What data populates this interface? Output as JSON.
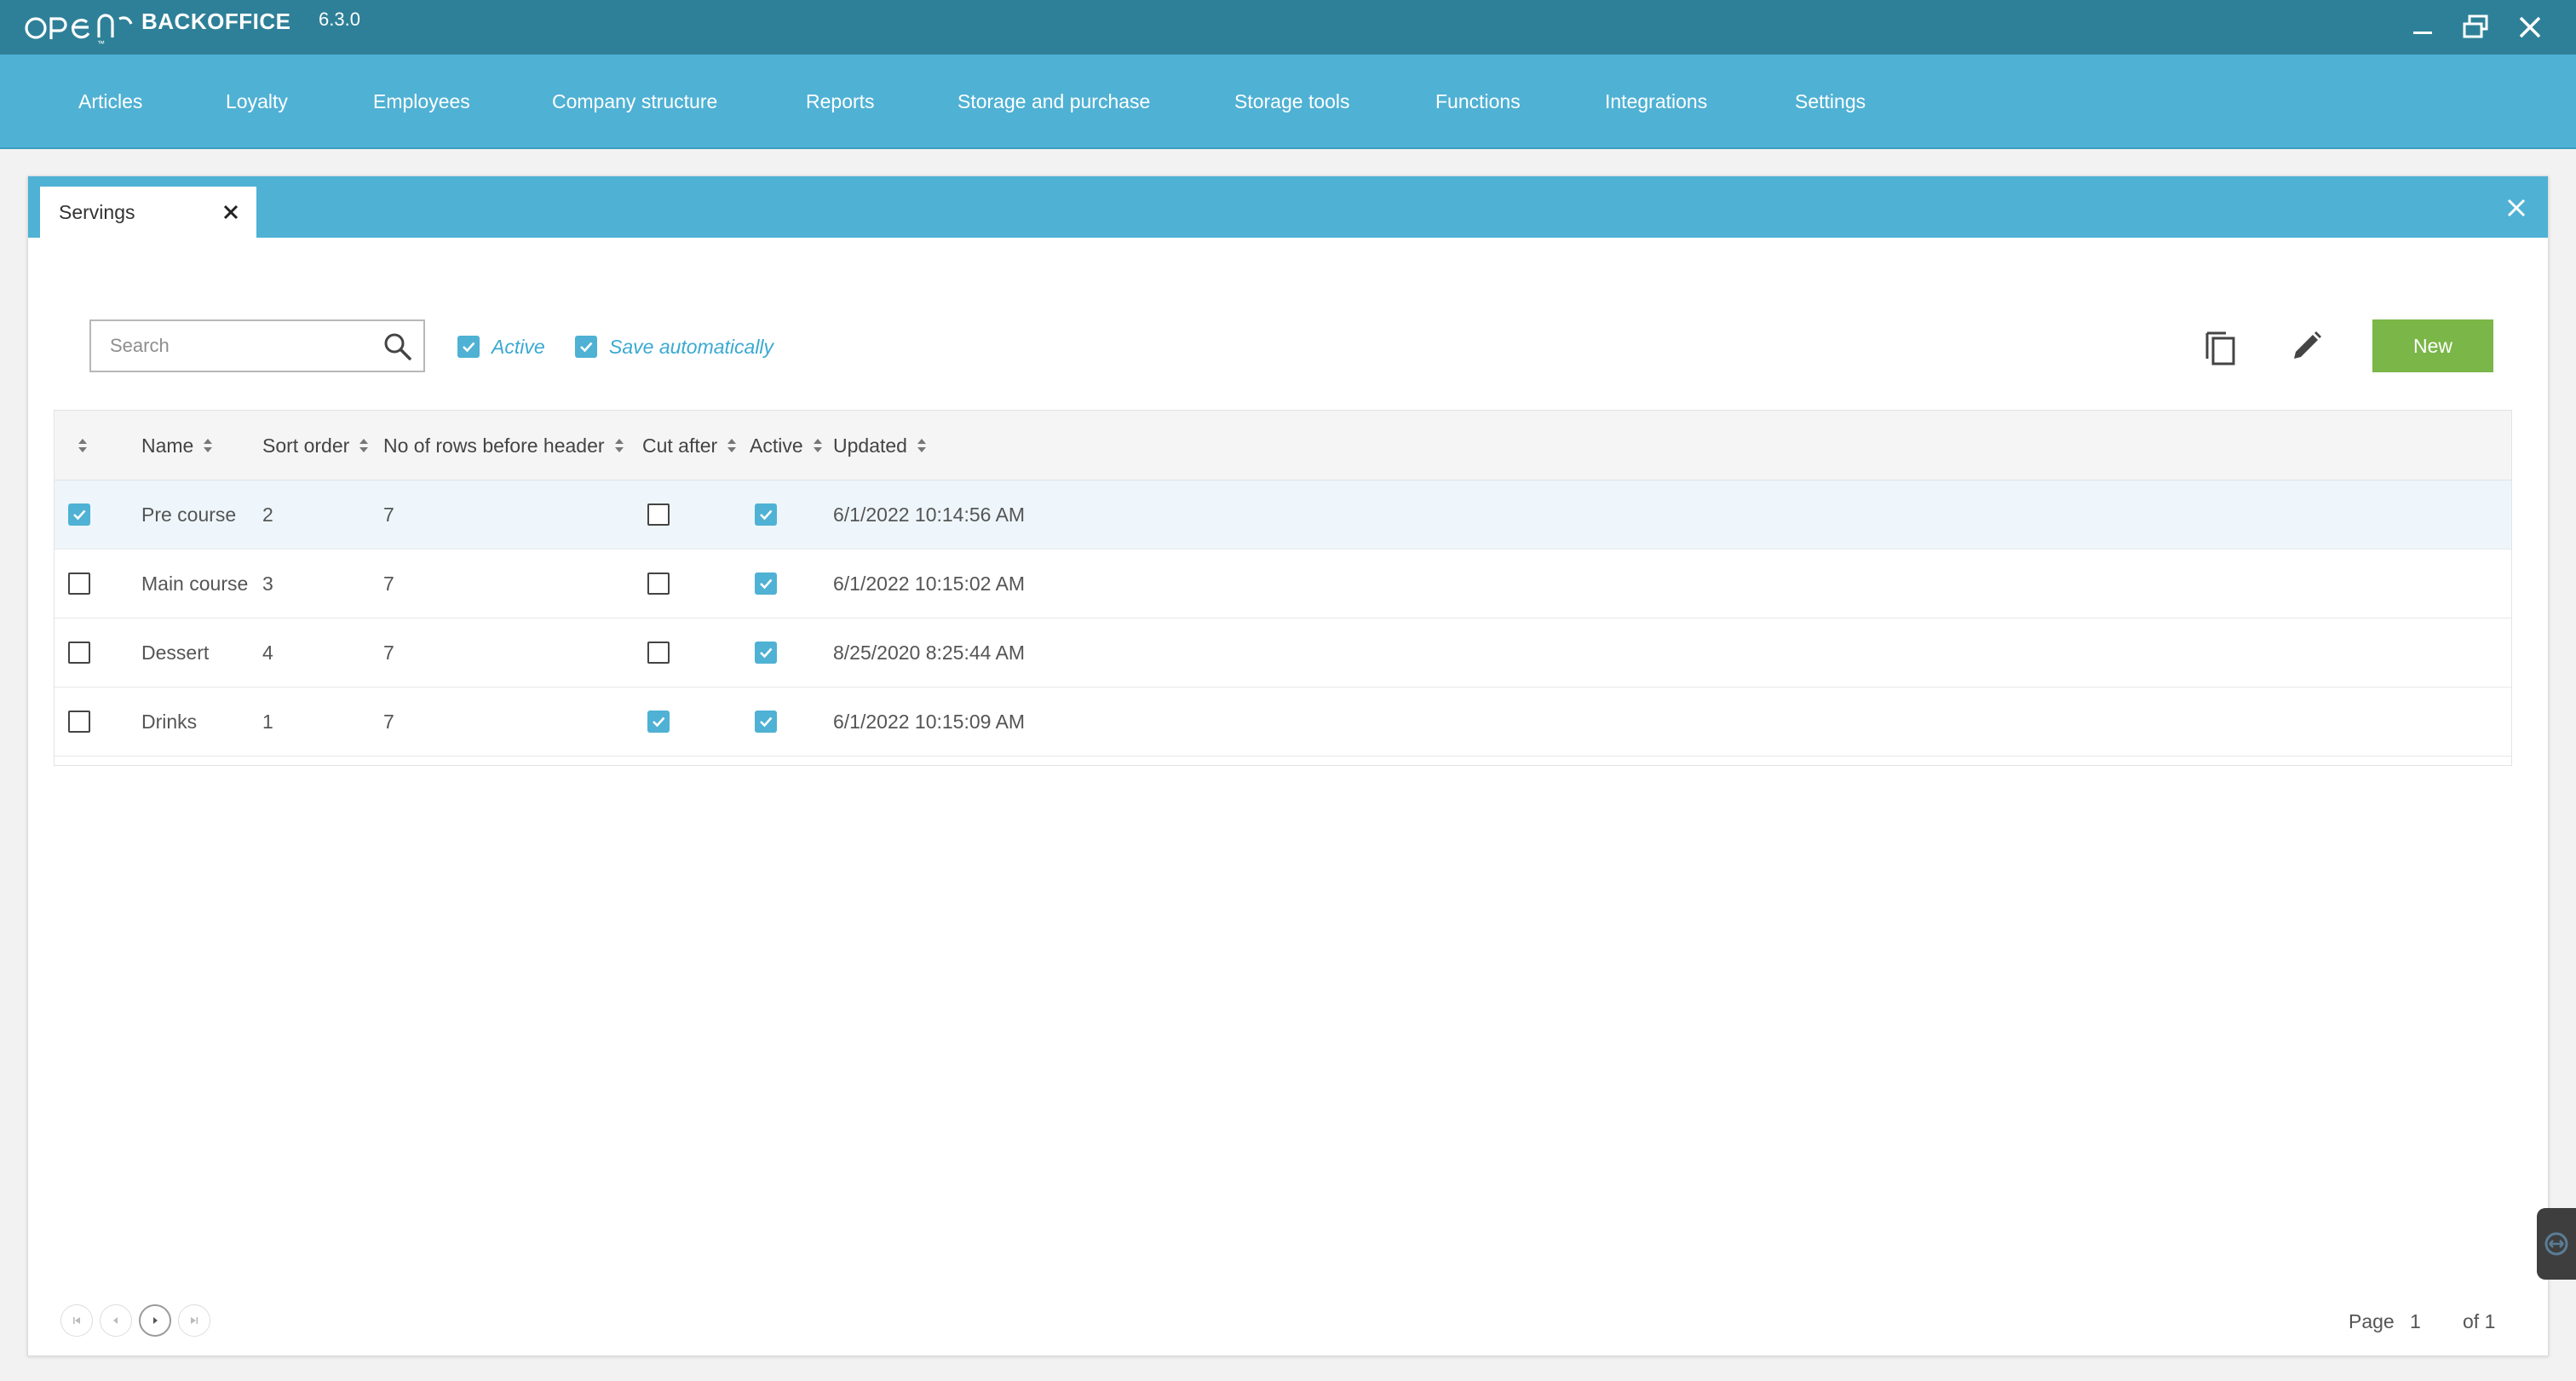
{
  "app": {
    "name": "BACKOFFICE",
    "version": "6.3.0"
  },
  "menu": [
    {
      "label": "Articles"
    },
    {
      "label": "Loyalty"
    },
    {
      "label": "Employees"
    },
    {
      "label": "Company structure"
    },
    {
      "label": "Reports"
    },
    {
      "label": "Storage and purchase"
    },
    {
      "label": "Storage tools"
    },
    {
      "label": "Functions"
    },
    {
      "label": "Integrations"
    },
    {
      "label": "Settings"
    }
  ],
  "tab": {
    "title": "Servings"
  },
  "toolbar": {
    "search_placeholder": "Search",
    "active_label": "Active",
    "active_checked": true,
    "save_auto_label": "Save automatically",
    "save_auto_checked": true,
    "new_label": "New"
  },
  "table": {
    "columns": [
      "Name",
      "Sort order",
      "No of rows before header",
      "Cut after",
      "Active",
      "Updated"
    ],
    "rows": [
      {
        "selected": true,
        "name": "Pre course",
        "sort_order": "2",
        "rows_before_header": "7",
        "cut_after": false,
        "active": true,
        "updated": "6/1/2022 10:14:56 AM"
      },
      {
        "selected": false,
        "name": "Main course",
        "sort_order": "3",
        "rows_before_header": "7",
        "cut_after": false,
        "active": true,
        "updated": "6/1/2022 10:15:02 AM"
      },
      {
        "selected": false,
        "name": "Dessert",
        "sort_order": "4",
        "rows_before_header": "7",
        "cut_after": false,
        "active": true,
        "updated": "8/25/2020 8:25:44 AM"
      },
      {
        "selected": false,
        "name": "Drinks",
        "sort_order": "1",
        "rows_before_header": "7",
        "cut_after": true,
        "active": true,
        "updated": "6/1/2022 10:15:09 AM"
      }
    ]
  },
  "pagination": {
    "page_label": "Page",
    "current_page": "1",
    "of_label": "of 1"
  },
  "colors": {
    "titlebar": "#2e8098",
    "menubar": "#4fb1d4",
    "accent": "#4fb1d4",
    "new_button": "#7ab648"
  }
}
